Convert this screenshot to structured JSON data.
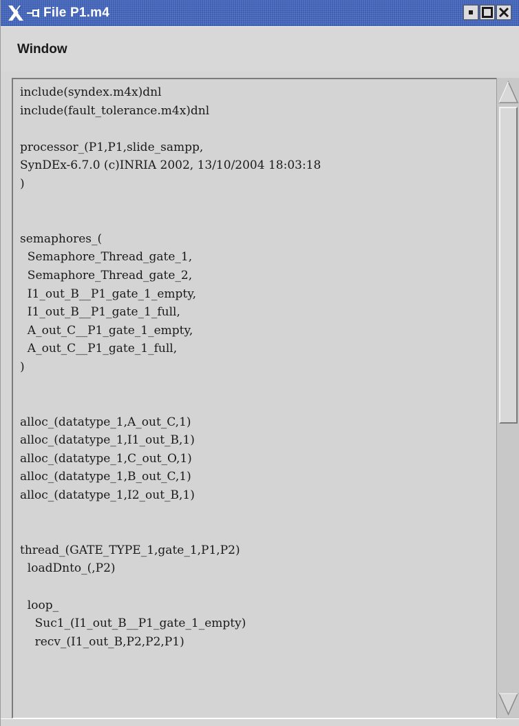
{
  "window": {
    "title": "File P1.m4",
    "titlebar_color": "#3d5fb4",
    "icons": [
      "x-logo-icon",
      "pin-icon",
      "minimize-icon",
      "maximize-icon",
      "close-icon"
    ]
  },
  "menubar": {
    "items": [
      {
        "label": "Window"
      }
    ]
  },
  "editor": {
    "lines": [
      "include(syndex.m4x)dnl",
      "include(fault_tolerance.m4x)dnl",
      "",
      "processor_(P1,P1,slide_sampp,",
      "SynDEx-6.7.0 (c)INRIA 2002, 13/10/2004 18:03:18",
      ")",
      "",
      "",
      "semaphores_(",
      "  Semaphore_Thread_gate_1,",
      "  Semaphore_Thread_gate_2,",
      "  I1_out_B__P1_gate_1_empty,",
      "  I1_out_B__P1_gate_1_full,",
      "  A_out_C__P1_gate_1_empty,",
      "  A_out_C__P1_gate_1_full,",
      ")",
      "",
      "",
      "alloc_(datatype_1,A_out_C,1)",
      "alloc_(datatype_1,I1_out_B,1)",
      "alloc_(datatype_1,C_out_O,1)",
      "alloc_(datatype_1,B_out_C,1)",
      "alloc_(datatype_1,I2_out_B,1)",
      "",
      "",
      "thread_(GATE_TYPE_1,gate_1,P1,P2)",
      "  loadDnto_(,P2)",
      "",
      "  loop_",
      "    Suc1_(I1_out_B__P1_gate_1_empty)",
      "    recv_(I1_out_B,P2,P2,P1)"
    ]
  },
  "scrollbar": {
    "position": 0.0,
    "visible_fraction": 0.5
  }
}
